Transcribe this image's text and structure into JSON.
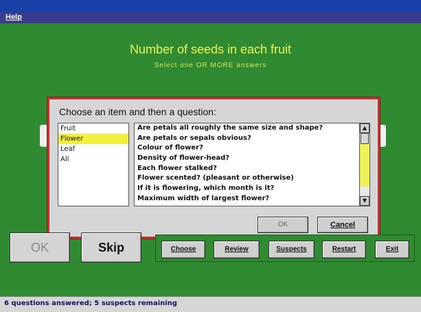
{
  "window": {
    "title": "",
    "menu_help": "Help"
  },
  "question": {
    "title": "Number of seeds in each fruit",
    "subtitle": "Select one OR MORE answers"
  },
  "dialog": {
    "title": "Choose an item and then a question:",
    "items": [
      "Fruit",
      "Flower",
      "Leaf",
      "All"
    ],
    "selected_item": "Flower",
    "questions": [
      "Are petals all roughly the same size and shape?",
      "Are petals or sepals obvious?",
      "Colour of flower?",
      "Density of flower-head?",
      "Each flower stalked?",
      "Flower scented? (pleasant or otherwise)",
      "If it is flowering, which month is it?",
      "Maximum width of largest flower?"
    ],
    "ok_label": "OK",
    "cancel_label": "Cancel"
  },
  "buttons": {
    "ok": "OK",
    "skip": "Skip",
    "choose": "Choose",
    "review": "Review",
    "suspects": "Suspects",
    "restart": "Restart",
    "exit": "Exit"
  },
  "status": {
    "text": "6 questions answered; 5 suspects remaining"
  },
  "colors": {
    "background": "#2f8a31",
    "dialog_border": "#c43232",
    "highlight": "#f2ee3d",
    "question_text": "#e9f35a"
  }
}
